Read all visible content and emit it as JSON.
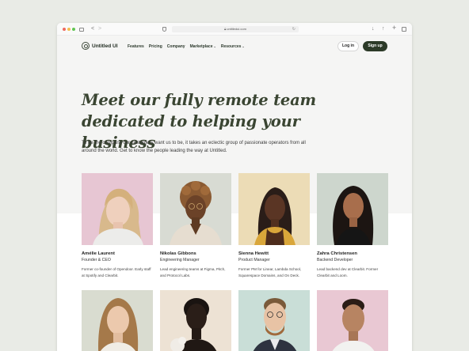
{
  "browser": {
    "url": "untitledui.com"
  },
  "nav": {
    "brand": "Untitled UI",
    "links": [
      {
        "label": "Features",
        "has_dropdown": false
      },
      {
        "label": "Pricing",
        "has_dropdown": false
      },
      {
        "label": "Company",
        "has_dropdown": false
      },
      {
        "label": "Marketplace",
        "has_dropdown": true
      },
      {
        "label": "Resources",
        "has_dropdown": true
      }
    ],
    "login_label": "Log in",
    "signup_label": "Sign up"
  },
  "hero": {
    "headline_line1": "Meet our fully remote team",
    "headline_line2": "dedicated to helping your business",
    "subtext": "To be the company our customers want us to be, it takes an eclectic group of passionate operators from all around the world. Get to know the people leading the way at Untitled."
  },
  "colors": {
    "brand_dark": "#2c3a28",
    "headline": "#3a4532"
  },
  "team": [
    {
      "name": "Amélie Laurent",
      "role": "Founder & CEO",
      "bio": "Former co-founder of Opendoor. Early staff at Spotify and Clearbit.",
      "bg": "#e7c6d3"
    },
    {
      "name": "Nikolas Gibbons",
      "role": "Engineering Manager",
      "bio": "Lead engineering teams at Figma, Pitch, and Protocol Labs.",
      "bg": "#d8dbd3"
    },
    {
      "name": "Sienna Hewitt",
      "role": "Product Manager",
      "bio": "Former PM for Linear, Lambda School, Squarespace Domains, and On Deck.",
      "bg": "#ecdcb6"
    },
    {
      "name": "Zahra Christensen",
      "role": "Backend Developer",
      "bio": "Lead backend dev at Clearbit. Former Clearbit and Loom.",
      "bg": "#cdd6cd"
    },
    {
      "bg": "#d9dcd0"
    },
    {
      "bg": "#ede2d4"
    },
    {
      "bg": "#c9ded7"
    },
    {
      "bg": "#e9c8d3"
    }
  ]
}
